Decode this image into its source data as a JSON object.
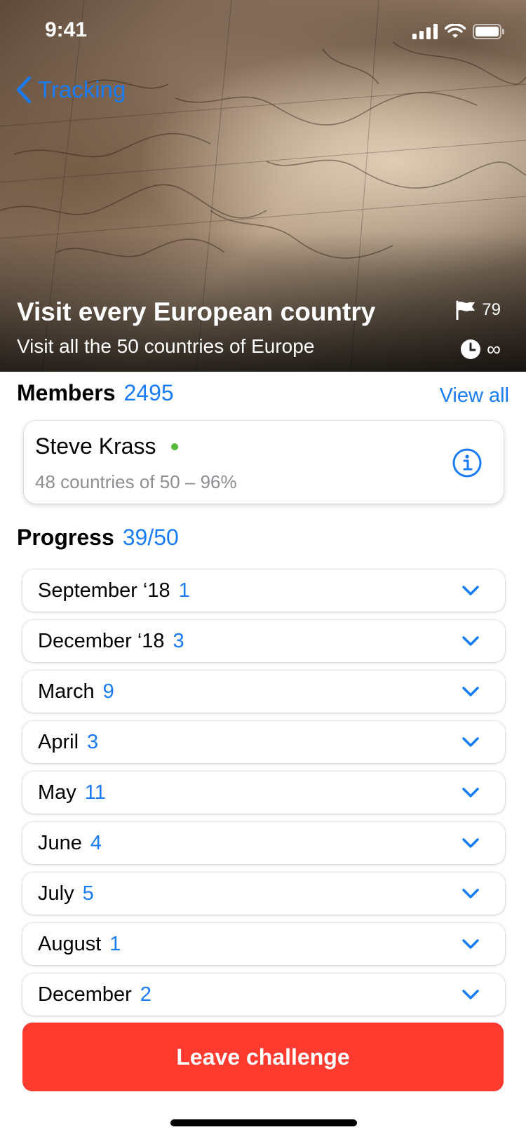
{
  "status_bar": {
    "time": "9:41"
  },
  "nav": {
    "back_label": "Tracking"
  },
  "challenge": {
    "title": "Visit every European country",
    "subtitle": "Visit all the 50 countries of Europe",
    "flag_count": "79",
    "duration": "∞"
  },
  "members": {
    "label": "Members",
    "count": "2495",
    "view_all": "View all",
    "member": {
      "name": "Steve Krass",
      "progress": "48 countries of 50 – 96%",
      "online": true
    }
  },
  "progress": {
    "label": "Progress",
    "value": "39/50",
    "months": [
      {
        "label": "September ‘18",
        "count": "1"
      },
      {
        "label": "December ‘18",
        "count": "3"
      },
      {
        "label": "March",
        "count": "9"
      },
      {
        "label": "April",
        "count": "3"
      },
      {
        "label": "May",
        "count": "11"
      },
      {
        "label": "June",
        "count": "4"
      },
      {
        "label": "July",
        "count": "5"
      },
      {
        "label": "August",
        "count": "1"
      },
      {
        "label": "December",
        "count": "2"
      }
    ]
  },
  "actions": {
    "leave_label": "Leave challenge"
  },
  "colors": {
    "accent": "#1a7cf5",
    "danger": "#ff3b30",
    "online": "#58b83a"
  }
}
